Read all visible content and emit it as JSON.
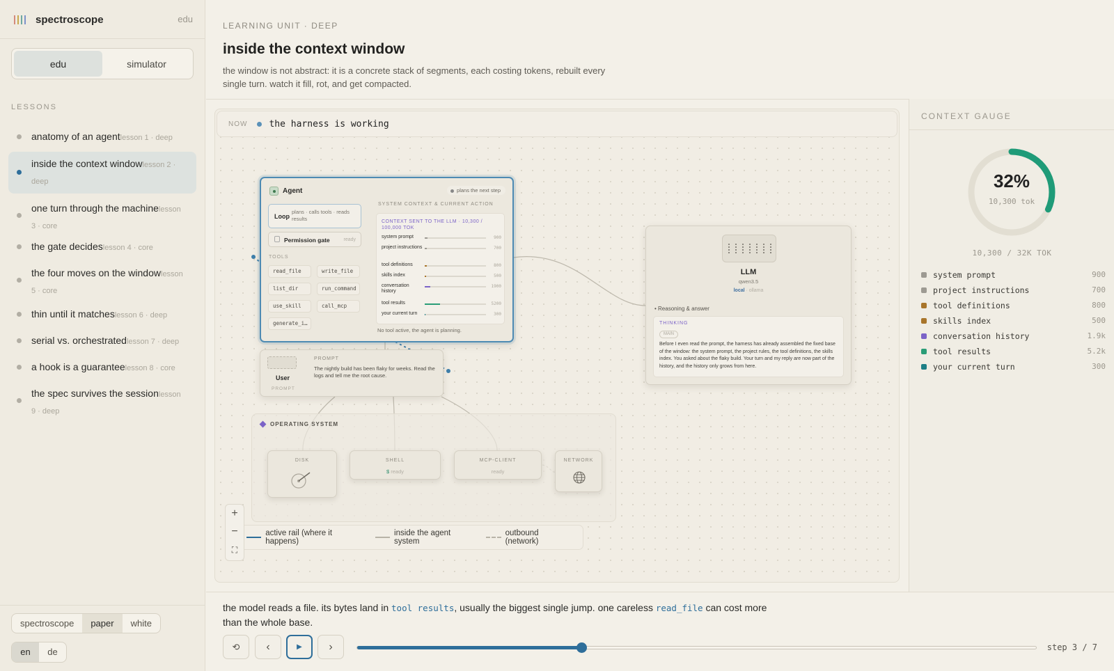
{
  "app": {
    "name": "spectroscope",
    "mode_badge": "edu"
  },
  "mode_toggle": [
    {
      "label": "edu",
      "active": true
    },
    {
      "label": "simulator",
      "active": false
    }
  ],
  "lessons_heading": "LESSONS",
  "lessons": [
    {
      "title": "anatomy of an agent",
      "meta": "lesson 1 · deep",
      "active": false
    },
    {
      "title": "inside the context window",
      "meta": "lesson 2 · deep",
      "active": true
    },
    {
      "title": "one turn through the machine",
      "meta": "lesson 3 · core",
      "active": false
    },
    {
      "title": "the gate decides",
      "meta": "lesson 4 · core",
      "active": false
    },
    {
      "title": "the four moves on the window",
      "meta": "lesson 5 · core",
      "active": false
    },
    {
      "title": "thin until it matches",
      "meta": "lesson 6 · deep",
      "active": false
    },
    {
      "title": "serial vs. orchestrated",
      "meta": "lesson 7 · deep",
      "active": false
    },
    {
      "title": "a hook is a guarantee",
      "meta": "lesson 8 · core",
      "active": false
    },
    {
      "title": "the spec survives the session",
      "meta": "lesson 9 · deep",
      "active": false
    }
  ],
  "theme_toggle": [
    {
      "label": "spectroscope",
      "active": false
    },
    {
      "label": "paper",
      "active": true
    },
    {
      "label": "white",
      "active": false
    }
  ],
  "lang_toggle": [
    {
      "label": "en",
      "active": true
    },
    {
      "label": "de",
      "active": false
    }
  ],
  "header": {
    "unit": "LEARNING UNIT · DEEP",
    "title": "inside the context window",
    "description": "the window is not abstract: it is a concrete stack of segments, each costing tokens, rebuilt every single turn. watch it fill, rot, and get compacted."
  },
  "now": {
    "label": "NOW",
    "text": "the harness is working"
  },
  "agent": {
    "title": "Agent",
    "status": "plans the next step",
    "loop_label": "Loop",
    "loop_desc": "plans · calls tools · reads results",
    "permission_label": "Permission gate",
    "permission_state": "ready",
    "tools_heading": "TOOLS",
    "tools": [
      "read_file",
      "write_file",
      "list_dir",
      "run_command",
      "use_skill",
      "call_mcp",
      "generate_i…"
    ],
    "context_heading": "SYSTEM CONTEXT & CURRENT ACTION",
    "context_sent": "CONTEXT SENT TO THE LLM · 10,300 / 100,000 TOK",
    "context_rows": [
      {
        "name": "system prompt",
        "value": "900",
        "color": "#9d9a92"
      },
      {
        "name": "project instructions",
        "value": "700",
        "color": "#9d9a92"
      },
      {
        "name": "tool definitions",
        "value": "800",
        "color": "#a8752a"
      },
      {
        "name": "skills index",
        "value": "500",
        "color": "#a8752a"
      },
      {
        "name": "conversation history",
        "value": "1900",
        "color": "#7b63c7"
      },
      {
        "name": "tool results",
        "value": "5200",
        "color": "#2a9d77"
      },
      {
        "name": "your current turn",
        "value": "300",
        "color": "#1d7f86"
      }
    ],
    "footer": "No tool active, the agent is planning."
  },
  "user": {
    "name": "User",
    "avatar_label": "PROMPT",
    "prompt_heading": "PROMPT",
    "prompt_text": "The nightly build has been flaky for weeks. Read the logs and tell me the root cause."
  },
  "os": {
    "heading": "OPERATING SYSTEM",
    "disk": {
      "title": "DISK"
    },
    "shell": {
      "title": "SHELL",
      "prompt": "$",
      "state": "ready"
    },
    "mcp": {
      "title": "MCP-CLIENT",
      "state": "ready"
    },
    "network": {
      "title": "NETWORK"
    }
  },
  "llm": {
    "name": "LLM",
    "model": "qwen3.5",
    "source_a": "local",
    "source_sep": " · ",
    "source_b": "ollama",
    "reasoning_label": "Reasoning & answer",
    "thinking_heading": "THINKING",
    "thinking_tag": "MAIN",
    "thinking_text": "Before I even read the prompt, the harness has already assembled the fixed base of the window: the system prompt, the project rules, the tool definitions, the skills index. You asked about the flaky build. Your turn and my reply are now part of the history, and the history only grows from here."
  },
  "zoom": {
    "in": "+",
    "out": "−",
    "fit": "⛶"
  },
  "legend": [
    {
      "label": "active rail (where it happens)",
      "style": "solid",
      "color": "#2e6e9a"
    },
    {
      "label": "inside the agent system",
      "style": "solid",
      "color": "#b8b3a7"
    },
    {
      "label": "outbound (network)",
      "style": "dashed",
      "color": "#b8b3a7"
    }
  ],
  "gauge": {
    "heading": "CONTEXT GAUGE",
    "percent_label": "32%",
    "percent": 0.32,
    "tokens": "10,300 tok",
    "total": "10,300 / 32K TOK",
    "accent": "#1f9b78",
    "segments": [
      {
        "name": "system prompt",
        "value": "900",
        "color": "#9d9a92"
      },
      {
        "name": "project instructions",
        "value": "700",
        "color": "#9d9a92"
      },
      {
        "name": "tool definitions",
        "value": "800",
        "color": "#a8752a"
      },
      {
        "name": "skills index",
        "value": "500",
        "color": "#a8752a"
      },
      {
        "name": "conversation history",
        "value": "1.9k",
        "color": "#7b63c7"
      },
      {
        "name": "tool results",
        "value": "5.2k",
        "color": "#2a9d77"
      },
      {
        "name": "your current turn",
        "value": "300",
        "color": "#1d7f86"
      }
    ]
  },
  "caption": {
    "part1": "the model reads a file. its bytes land in ",
    "code1": "tool results",
    "part2": ", usually the biggest single jump. one careless ",
    "code2": "read_file",
    "part3": " can cost more than the whole base."
  },
  "controls": {
    "reset": "⟲",
    "prev": "‹",
    "play": "▶",
    "next": "›"
  },
  "progress": {
    "fraction": 0.33,
    "label": "step 3 / 7"
  }
}
